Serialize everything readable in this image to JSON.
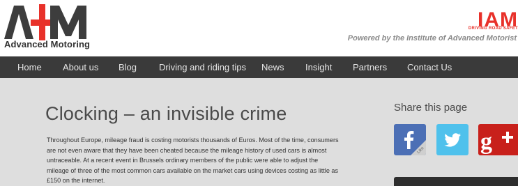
{
  "header": {
    "logo_text": "Advanced Motoring",
    "iam_word": "IAM",
    "iam_tagline": "DRIVING ROAD SAFET",
    "powered_by": "Powered by the Institute of Advanced Motorist"
  },
  "nav": {
    "items": [
      "Home",
      "About us",
      "Blog",
      "Driving and riding tips",
      "News",
      "Insight",
      "Partners",
      "Contact Us"
    ]
  },
  "article": {
    "title": "Clocking – an invisible crime",
    "body": "Throughout Europe, mileage fraud is costing motorists thousands of Euros. Most of the time, consumers are not even aware that they have been cheated because the mileage history of used cars is almost untraceable. At a recent event in Brussels ordinary members of the public were able to adjust the mileage of three of the most common cars available on the market cars using devices costing as little as £150 on the internet."
  },
  "share": {
    "title": "Share this page",
    "facebook_like": "Like",
    "icons": [
      "facebook-icon",
      "twitter-icon",
      "google-plus-icon"
    ]
  },
  "colors": {
    "nav_bg": "#3a3a3a",
    "main_bg": "#dedede",
    "iam_red": "#e8312a",
    "facebook": "#4c6fb5",
    "twitter": "#4fc1ec",
    "google_plus": "#c8201b"
  }
}
